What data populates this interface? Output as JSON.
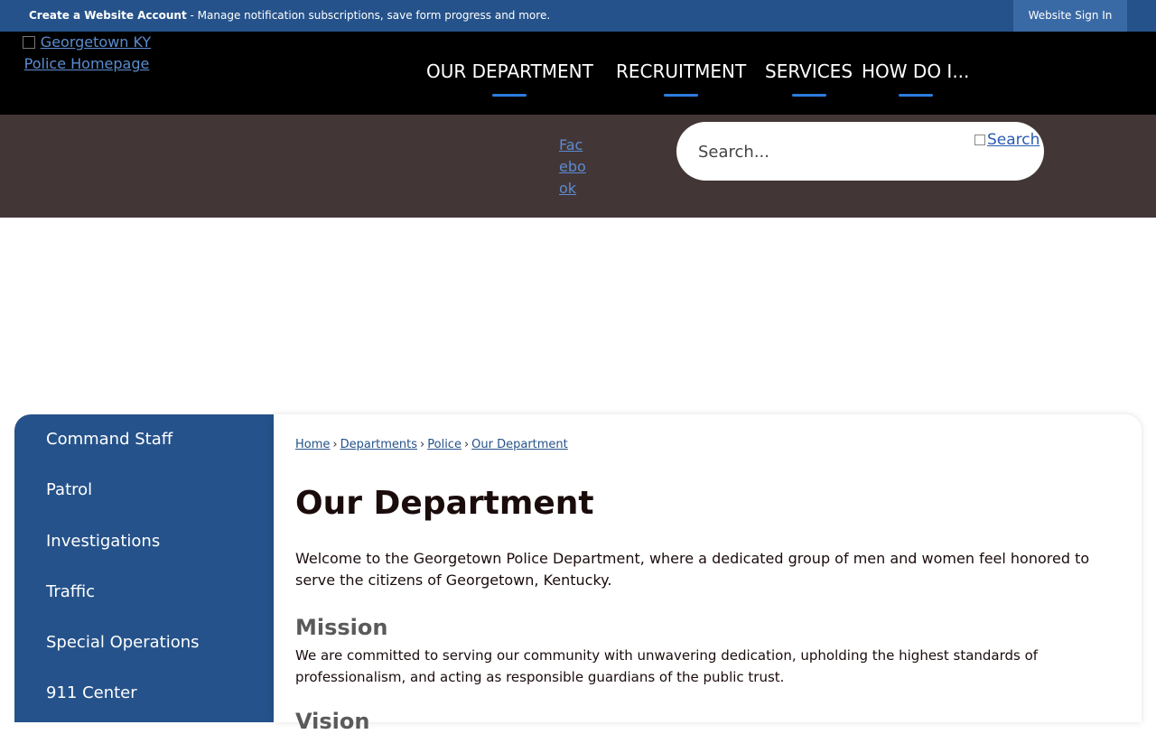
{
  "topbar": {
    "account_link": "Create a Website Account",
    "message": " - Manage notification subscriptions, save form progress and more.",
    "signin": "Website Sign In"
  },
  "header": {
    "logo_alt": "Georgetown KY Police Homepage",
    "nav": [
      {
        "label": "OUR DEPARTMENT"
      },
      {
        "label": "RECRUITMENT"
      },
      {
        "label": "SERVICES"
      },
      {
        "label": "HOW DO I..."
      }
    ]
  },
  "utility": {
    "facebook_alt": "Facebook",
    "search_placeholder": "Search...",
    "search_button": "Search"
  },
  "sidebar": {
    "items": [
      {
        "label": "Command Staff"
      },
      {
        "label": "Patrol"
      },
      {
        "label": "Investigations"
      },
      {
        "label": "Traffic"
      },
      {
        "label": "Special Operations"
      },
      {
        "label": "911 Center"
      }
    ]
  },
  "content": {
    "breadcrumb": [
      "Home",
      "Departments",
      "Police",
      "Our Department"
    ],
    "title": "Our Department",
    "intro": "Welcome to the Georgetown Police Department, where a dedicated group of men and women feel honored to serve the citizens of Georgetown, Kentucky.",
    "mission_heading": "Mission",
    "mission_text": "We are committed to serving our community with unwavering dedication, upholding the highest standards of professionalism, and acting as responsible guardians of the public trust.",
    "vision_heading": "Vision"
  },
  "colors": {
    "brand_blue": "#25528a",
    "accent_blue": "#2e7de0",
    "band_brown": "#433637"
  }
}
